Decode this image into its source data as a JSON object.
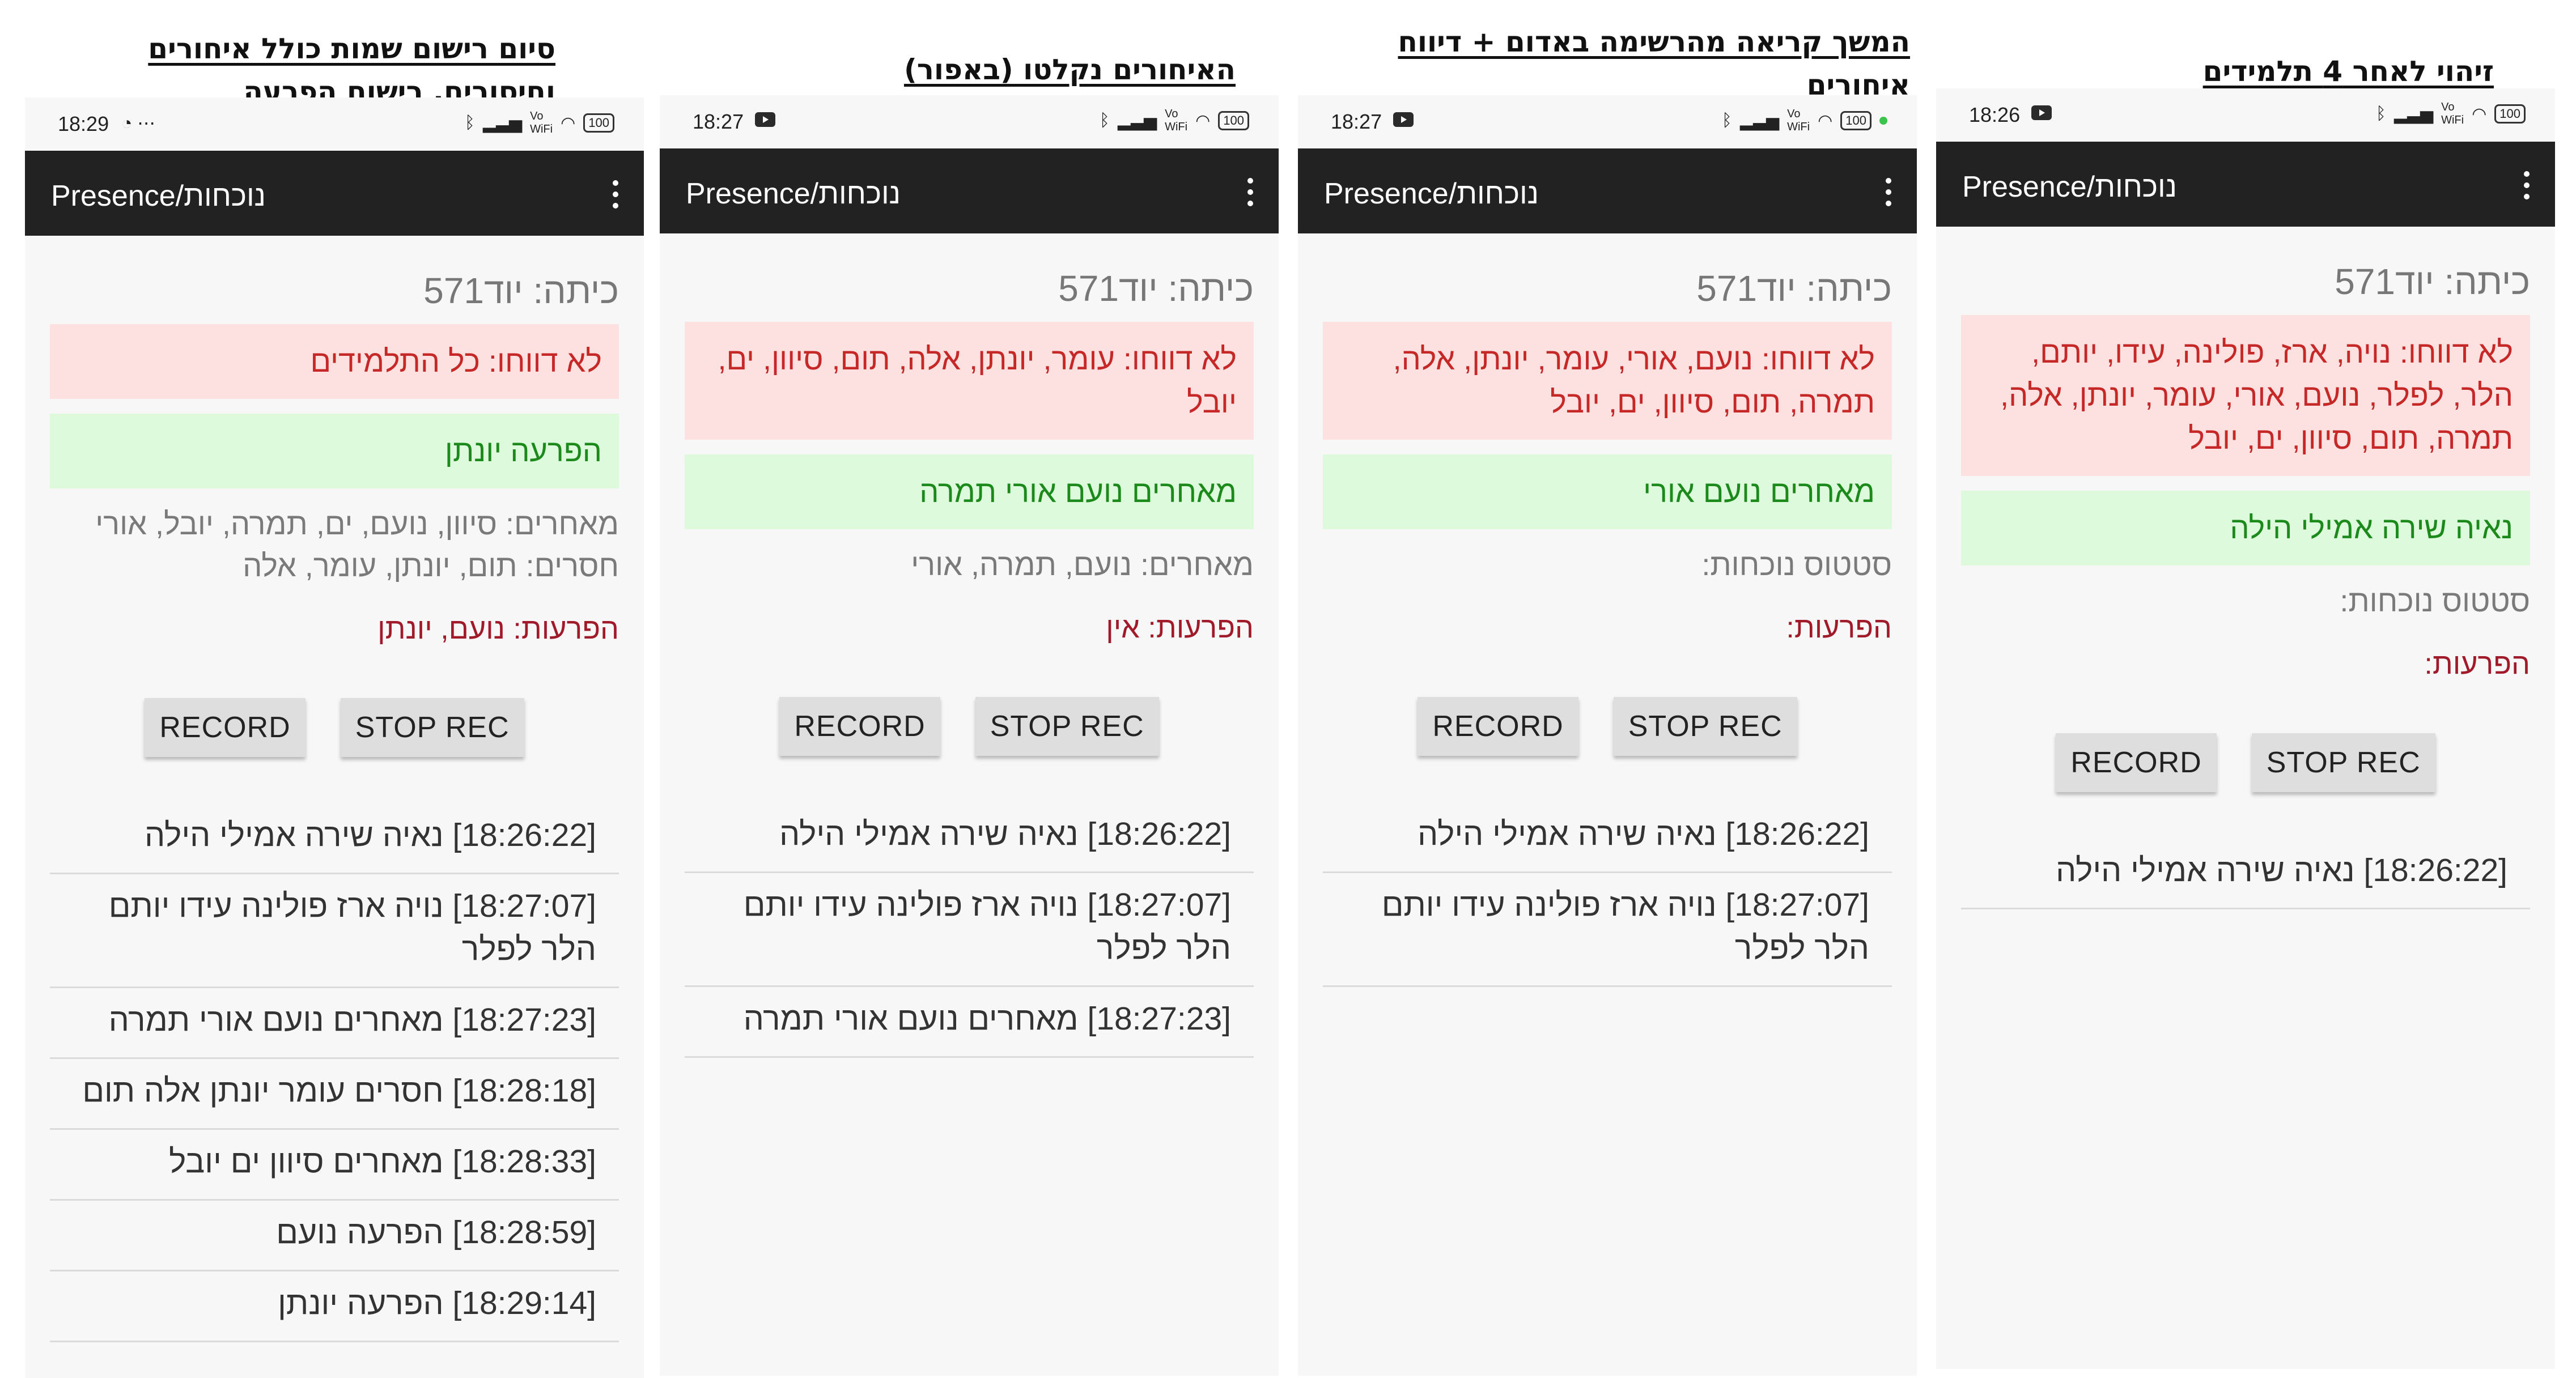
{
  "panels": [
    {
      "caption": "סיום רישום שמות כולל איחורים וחיסורים. רישום הפרעה",
      "status_time": "18:29",
      "app_title": "Presence/נוכחות",
      "class_line": "כיתה: יוד571",
      "not_reported": "לא דווחו: כל התלמידים",
      "green_line": "הפרעה יונתן",
      "status_lines": [
        "מאחרים: סיוון, נועם, ים, תמרה, יובל, אורי",
        "חסרים: תום, יונתן, עומר, אלה"
      ],
      "disruptions": "הפרעות: נועם, יונתן",
      "record_label": "RECORD",
      "stop_label": "STOP REC",
      "log": [
        "[18:26:22] נאיה שירה אמילי הילה",
        "[18:27:07] נויה ארז פולינה עידו יותם הלר לפלר",
        "[18:27:23] מאחרים נועם אורי תמרה",
        "[18:28:18] חסרים עומר יונתן אלה תום",
        "[18:28:33] מאחרים סיוון ים יובל",
        "[18:28:59] הפרעה נועם",
        "[18:29:14] הפרעה יונתן"
      ]
    },
    {
      "caption": "האיחורים נקלטו (באפור)",
      "status_time": "18:27",
      "app_title": "Presence/נוכחות",
      "class_line": "כיתה: יוד571",
      "not_reported": "לא דווחו: עומר, יונתן, אלה, תום, סיוון, ים, יובל",
      "green_line": "מאחרים נועם אורי תמרה",
      "status_lines": [
        "מאחרים: נועם, תמרה, אורי"
      ],
      "disruptions": "הפרעות: אין",
      "record_label": "RECORD",
      "stop_label": "STOP REC",
      "log": [
        "[18:26:22] נאיה שירה אמילי הילה",
        "[18:27:07] נויה ארז פולינה עידו יותם הלר לפלר",
        "[18:27:23] מאחרים נועם אורי תמרה"
      ]
    },
    {
      "caption": "המשך קריאה מהרשימה באדום + דיווח איחורים",
      "status_time": "18:27",
      "app_title": "Presence/נוכחות",
      "class_line": "כיתה: יוד571",
      "not_reported": "לא דווחו: נועם, אורי, עומר, יונתן, אלה, תמרה, תום, סיוון, ים, יובל",
      "green_line": "מאחרים נועם אורי",
      "status_lines": [
        "סטטוס נוכחות:"
      ],
      "disruptions": "הפרעות:",
      "record_label": "RECORD",
      "stop_label": "STOP REC",
      "log": [
        "[18:26:22] נאיה שירה אמילי הילה",
        "[18:27:07] נויה ארז פולינה עידו יותם הלר לפלר"
      ]
    },
    {
      "caption": "זיהוי לאחר 4 תלמידים",
      "status_time": "18:26",
      "app_title": "Presence/נוכחות",
      "class_line": "כיתה: יוד571",
      "not_reported": "לא דווחו: נויה, ארז, פולינה, עידו, יותם, הלר, לפלר, נועם, אורי, עומר, יונתן, אלה, תמרה, תום, סיוון, ים, יובל",
      "green_line": "נאיה שירה אמילי הילה",
      "status_lines": [
        "סטטוס נוכחות:"
      ],
      "disruptions": "הפרעות:",
      "record_label": "RECORD",
      "stop_label": "STOP REC",
      "log": [
        "[18:26:22] נאיה שירה אמילי הילה"
      ]
    }
  ],
  "colors": {
    "not_reported_bg": "#fde0e0",
    "not_reported_text": "#c62828",
    "green_bg": "#ddfbdc",
    "green_text": "#1b8a1b",
    "disruptions_text": "#a11a2a",
    "appbar": "#222222"
  },
  "icons": {
    "status_bar": [
      "bluetooth-icon",
      "signal-icon",
      "vowifi-icon",
      "wifi-icon",
      "battery-icon"
    ],
    "menu": "kebab-menu-icon"
  }
}
